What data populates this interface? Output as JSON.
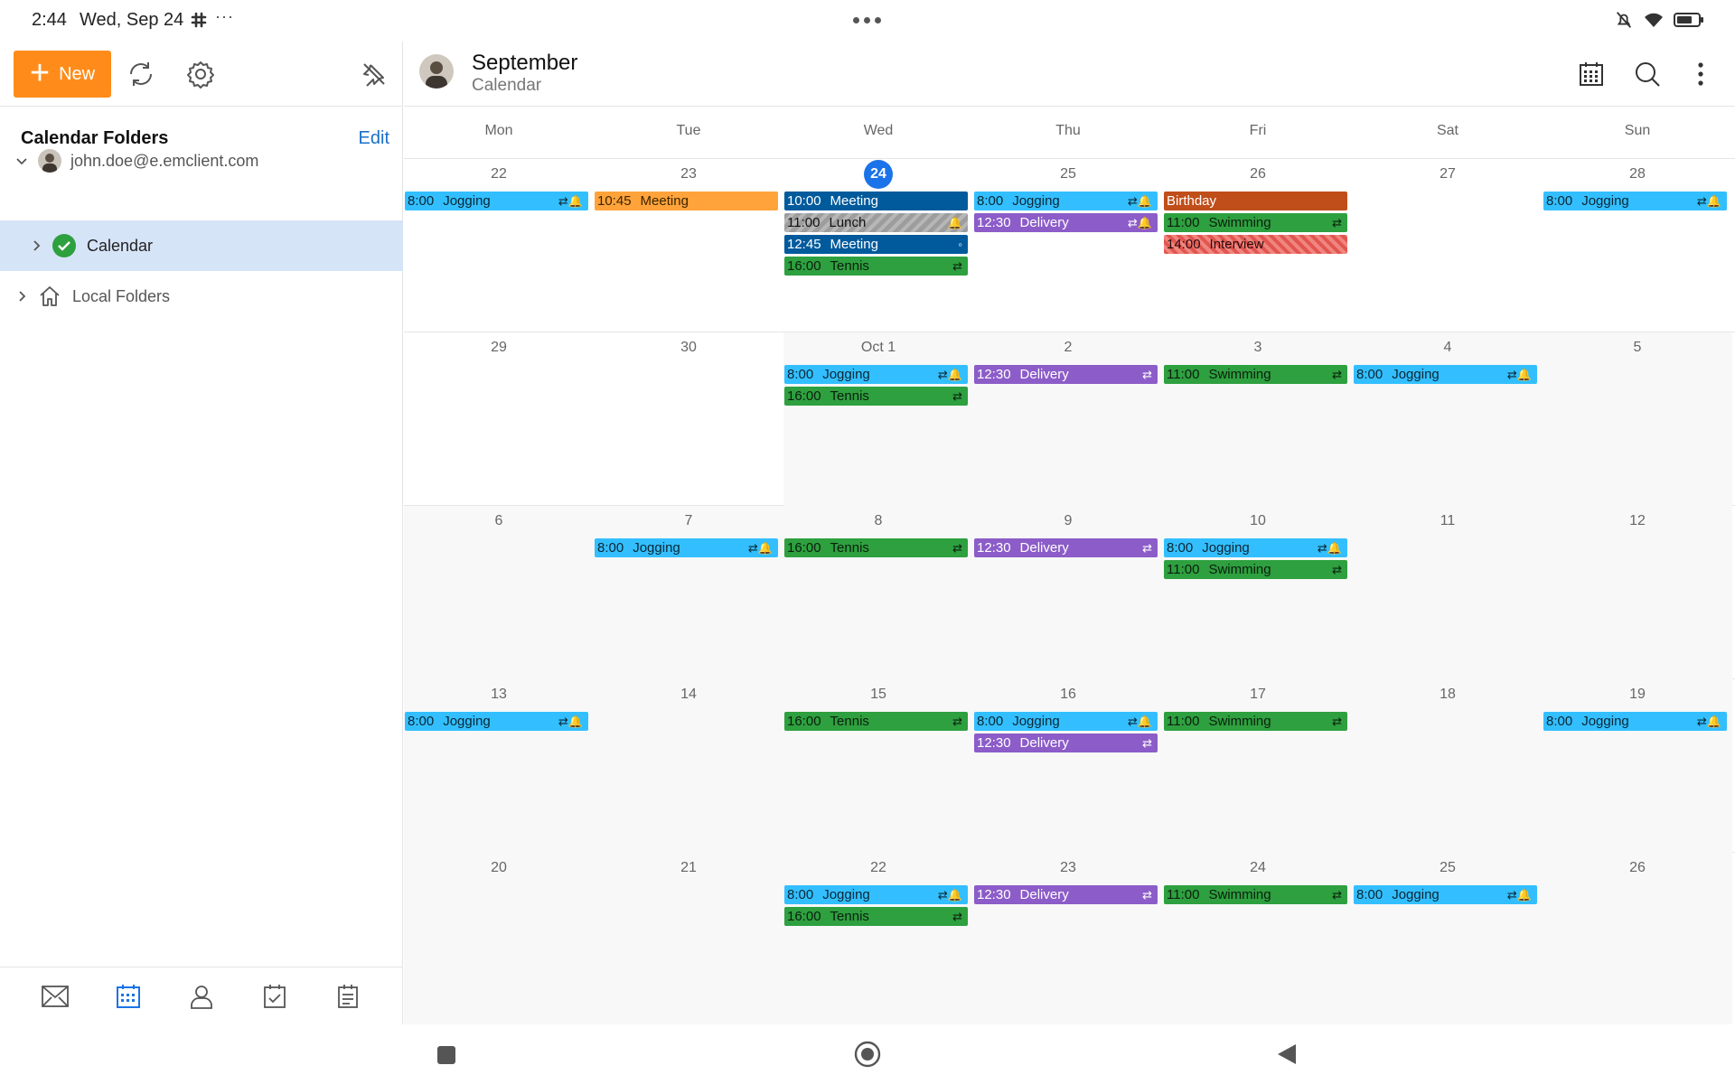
{
  "status_bar": {
    "time": "2:44",
    "date": "Wed, Sep 24",
    "more": "···"
  },
  "toolbar": {
    "new_label": "New"
  },
  "folders": {
    "heading": "Calendar Folders",
    "edit_label": "Edit",
    "account": "john.doe@e.emclient.com",
    "calendar": "Calendar",
    "local": "Local Folders"
  },
  "header": {
    "title": "September",
    "subtitle": "Calendar"
  },
  "weekdays": [
    "Mon",
    "Tue",
    "Wed",
    "Thu",
    "Fri",
    "Sat",
    "Sun"
  ],
  "colors": {
    "accent": "#ff8c1a",
    "today": "#1a73e8",
    "selected_row": "#d6e4f7",
    "jogging": "#33bfff",
    "meeting_tue": "#ffa33a",
    "meeting_wed": "#005a9c",
    "tennis": "#2ea03f",
    "delivery": "#8c5cc8",
    "birthday": "#c04e1a",
    "swimming": "#2ea03f",
    "interview": "#e2564f",
    "lunch": "#9d9d9d"
  },
  "weeks": [
    {
      "days": [
        {
          "label": "22",
          "events": [
            {
              "time": "8:00",
              "title": "Jogging",
              "cls": "c-jog",
              "icons": "⇄🔔"
            }
          ]
        },
        {
          "label": "23",
          "events": [
            {
              "time": "10:45",
              "title": "Meeting",
              "cls": "c-meet-o",
              "icons": ""
            }
          ]
        },
        {
          "label": "24",
          "today": true,
          "events": [
            {
              "time": "10:00",
              "title": "Meeting",
              "cls": "c-meet-b",
              "icons": ""
            },
            {
              "time": "11:00",
              "title": "Lunch",
              "cls": "c-lunch",
              "icons": "🔔"
            },
            {
              "time": "12:45",
              "title": "Meeting",
              "cls": "c-meet-b",
              "icons": "◦"
            },
            {
              "time": "16:00",
              "title": "Tennis",
              "cls": "c-tennis",
              "icons": "⇄"
            }
          ]
        },
        {
          "label": "25",
          "events": [
            {
              "time": "8:00",
              "title": "Jogging",
              "cls": "c-jog",
              "icons": "⇄🔔"
            },
            {
              "time": "12:30",
              "title": "Delivery",
              "cls": "c-deliv",
              "icons": "⇄🔔"
            }
          ]
        },
        {
          "label": "26",
          "events": [
            {
              "time": "",
              "title": "Birthday",
              "cls": "c-bday",
              "icons": ""
            },
            {
              "time": "11:00",
              "title": "Swimming",
              "cls": "c-swim",
              "icons": "⇄"
            },
            {
              "time": "14:00",
              "title": "Interview",
              "cls": "c-interview",
              "icons": ""
            }
          ]
        },
        {
          "label": "27",
          "events": []
        },
        {
          "label": "28",
          "events": [
            {
              "time": "8:00",
              "title": "Jogging",
              "cls": "c-jog",
              "icons": "⇄🔔"
            }
          ]
        }
      ]
    },
    {
      "days": [
        {
          "label": "29",
          "events": []
        },
        {
          "label": "30",
          "events": []
        },
        {
          "label": "Oct  1",
          "gray": true,
          "events": [
            {
              "time": "8:00",
              "title": "Jogging",
              "cls": "c-jog",
              "icons": "⇄🔔"
            },
            {
              "time": "16:00",
              "title": "Tennis",
              "cls": "c-tennis",
              "icons": "⇄"
            }
          ]
        },
        {
          "label": "2",
          "gray": true,
          "events": [
            {
              "time": "12:30",
              "title": "Delivery",
              "cls": "c-deliv",
              "icons": "⇄"
            }
          ]
        },
        {
          "label": "3",
          "gray": true,
          "events": [
            {
              "time": "11:00",
              "title": "Swimming",
              "cls": "c-swim",
              "icons": "⇄"
            }
          ]
        },
        {
          "label": "4",
          "gray": true,
          "events": [
            {
              "time": "8:00",
              "title": "Jogging",
              "cls": "c-jog",
              "icons": "⇄🔔"
            }
          ]
        },
        {
          "label": "5",
          "gray": true,
          "events": []
        }
      ]
    },
    {
      "days": [
        {
          "label": "6",
          "gray": true,
          "events": []
        },
        {
          "label": "7",
          "gray": true,
          "events": [
            {
              "time": "8:00",
              "title": "Jogging",
              "cls": "c-jog",
              "icons": "⇄🔔"
            }
          ]
        },
        {
          "label": "8",
          "gray": true,
          "events": [
            {
              "time": "16:00",
              "title": "Tennis",
              "cls": "c-tennis",
              "icons": "⇄"
            }
          ]
        },
        {
          "label": "9",
          "gray": true,
          "events": [
            {
              "time": "12:30",
              "title": "Delivery",
              "cls": "c-deliv",
              "icons": "⇄"
            }
          ]
        },
        {
          "label": "10",
          "gray": true,
          "events": [
            {
              "time": "8:00",
              "title": "Jogging",
              "cls": "c-jog",
              "icons": "⇄🔔"
            },
            {
              "time": "11:00",
              "title": "Swimming",
              "cls": "c-swim",
              "icons": "⇄"
            }
          ]
        },
        {
          "label": "11",
          "gray": true,
          "events": []
        },
        {
          "label": "12",
          "gray": true,
          "events": []
        }
      ]
    },
    {
      "days": [
        {
          "label": "13",
          "gray": true,
          "events": [
            {
              "time": "8:00",
              "title": "Jogging",
              "cls": "c-jog",
              "icons": "⇄🔔"
            }
          ]
        },
        {
          "label": "14",
          "gray": true,
          "events": []
        },
        {
          "label": "15",
          "gray": true,
          "events": [
            {
              "time": "16:00",
              "title": "Tennis",
              "cls": "c-tennis",
              "icons": "⇄"
            }
          ]
        },
        {
          "label": "16",
          "gray": true,
          "events": [
            {
              "time": "8:00",
              "title": "Jogging",
              "cls": "c-jog",
              "icons": "⇄🔔"
            },
            {
              "time": "12:30",
              "title": "Delivery",
              "cls": "c-deliv",
              "icons": "⇄"
            }
          ]
        },
        {
          "label": "17",
          "gray": true,
          "events": [
            {
              "time": "11:00",
              "title": "Swimming",
              "cls": "c-swim",
              "icons": "⇄"
            }
          ]
        },
        {
          "label": "18",
          "gray": true,
          "events": []
        },
        {
          "label": "19",
          "gray": true,
          "events": [
            {
              "time": "8:00",
              "title": "Jogging",
              "cls": "c-jog",
              "icons": "⇄🔔"
            }
          ]
        }
      ]
    },
    {
      "days": [
        {
          "label": "20",
          "gray": true,
          "events": []
        },
        {
          "label": "21",
          "gray": true,
          "events": []
        },
        {
          "label": "22",
          "gray": true,
          "events": [
            {
              "time": "8:00",
              "title": "Jogging",
              "cls": "c-jog",
              "icons": "⇄🔔"
            },
            {
              "time": "16:00",
              "title": "Tennis",
              "cls": "c-tennis",
              "icons": "⇄"
            }
          ]
        },
        {
          "label": "23",
          "gray": true,
          "events": [
            {
              "time": "12:30",
              "title": "Delivery",
              "cls": "c-deliv",
              "icons": "⇄"
            }
          ]
        },
        {
          "label": "24",
          "gray": true,
          "events": [
            {
              "time": "11:00",
              "title": "Swimming",
              "cls": "c-swim",
              "icons": "⇄"
            }
          ]
        },
        {
          "label": "25",
          "gray": true,
          "events": [
            {
              "time": "8:00",
              "title": "Jogging",
              "cls": "c-jog",
              "icons": "⇄🔔"
            }
          ]
        },
        {
          "label": "26",
          "gray": true,
          "events": []
        }
      ]
    }
  ]
}
